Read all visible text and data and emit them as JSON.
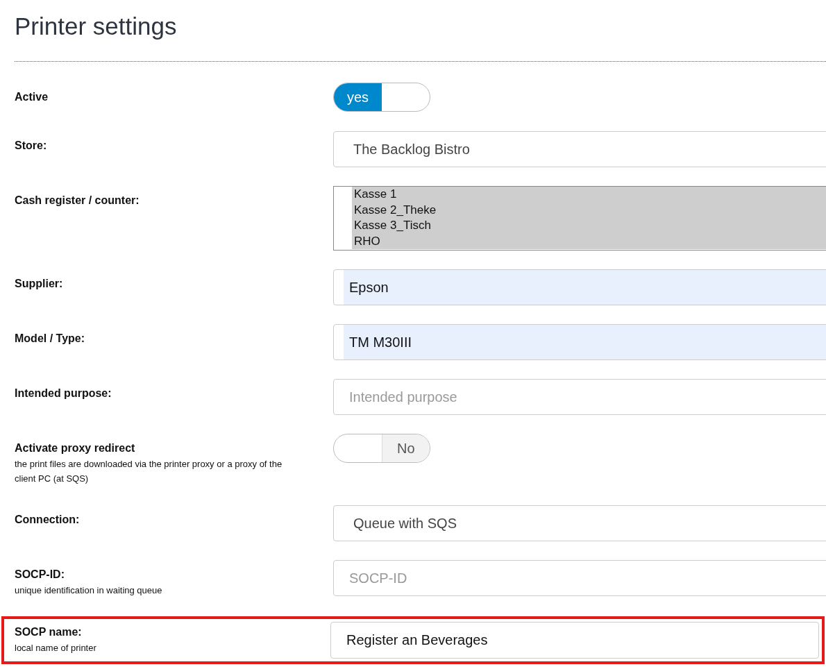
{
  "title": "Printer settings",
  "rows": [
    {
      "kind": "toggle",
      "label": "Active",
      "on": true,
      "on_text": "yes"
    },
    {
      "kind": "select",
      "label": "Store:",
      "value": "The Backlog Bistro"
    },
    {
      "kind": "listbox",
      "label": "Cash register / counter:",
      "options": [
        {
          "label": "Kasse 1",
          "selected": true
        },
        {
          "label": "Kasse 2_Theke",
          "selected": true
        },
        {
          "label": "Kasse 3_Tisch",
          "selected": true
        },
        {
          "label": "RHO",
          "selected": true
        }
      ]
    },
    {
      "kind": "input",
      "label": "Supplier:",
      "value": "Epson",
      "autofilled": true
    },
    {
      "kind": "input",
      "label": "Model / Type:",
      "value": "TM M30III",
      "autofilled": true
    },
    {
      "kind": "input",
      "label": "Intended purpose:",
      "placeholder": "Intended purpose",
      "autofilled": false
    },
    {
      "kind": "toggle",
      "label": "Activate proxy redirect",
      "hint": "the print files are downloaded via the printer proxy or a proxy of the client PC (at SQS)",
      "on": false,
      "off_text": "No"
    },
    {
      "kind": "select",
      "label": "Connection:",
      "value": "Queue with SQS"
    },
    {
      "kind": "input",
      "label": "SOCP-ID:",
      "hint": "unique identification in waiting queue",
      "placeholder": "SOCP-ID",
      "autofilled": false
    },
    {
      "kind": "input",
      "label": "SOCP name:",
      "hint": "local name of printer",
      "value": "Register an Beverages",
      "autofilled": false,
      "highlighted": true
    }
  ]
}
